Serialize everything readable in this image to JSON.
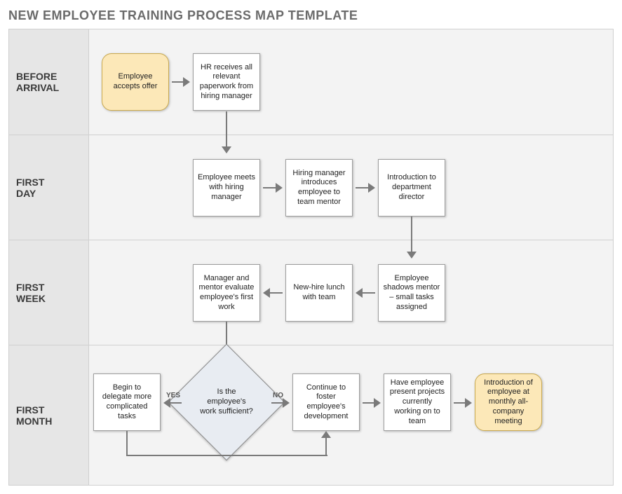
{
  "title": "NEW EMPLOYEE TRAINING PROCESS MAP TEMPLATE",
  "rows": {
    "before": {
      "label_l1": "BEFORE",
      "label_l2": "ARRIVAL"
    },
    "day": {
      "label_l1": "FIRST",
      "label_l2": "DAY"
    },
    "week": {
      "label_l1": "FIRST",
      "label_l2": "WEEK"
    },
    "month": {
      "label_l1": "FIRST",
      "label_l2": "MONTH"
    }
  },
  "nodes": {
    "accept": "Employee accepts offer",
    "hr_paper": "HR receives all relevant paperwork from hiring manager",
    "meet_mgr": "Employee meets with hiring manager",
    "intro_mentor": "Hiring manager introduces employee to team mentor",
    "intro_dir": "Introduction to department director",
    "shadow": "Employee shadows mentor – small tasks assigned",
    "lunch": "New-hire lunch with team",
    "evaluate": "Manager and mentor evaluate employee's first work",
    "decision": "Is the employee's work sufficient?",
    "delegate": "Begin to delegate more complicated tasks",
    "foster": "Continue to foster employee's development",
    "present": "Have employee present projects currently working on to team",
    "monthly": "Introduction of employee at monthly all-company meeting"
  },
  "labels": {
    "yes": "YES",
    "no": "NO"
  }
}
